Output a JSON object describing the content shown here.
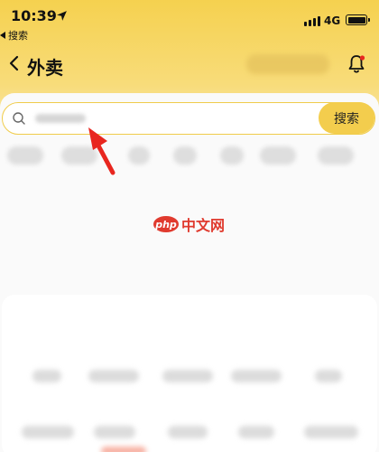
{
  "status_bar": {
    "time": "10:39",
    "network": "4G",
    "back_app_label": "搜索"
  },
  "nav": {
    "back_icon": "chevron-left-icon",
    "title": "外卖",
    "notification_icon": "bell-icon"
  },
  "search": {
    "placeholder": "",
    "button_label": "搜索"
  },
  "watermark": {
    "badge": "php",
    "text": "中文网"
  },
  "colors": {
    "header_yellow": "#f5d14f",
    "search_button": "#f3cd4d",
    "annotation_red": "#e8261f",
    "logo_red": "#e03a2e"
  }
}
